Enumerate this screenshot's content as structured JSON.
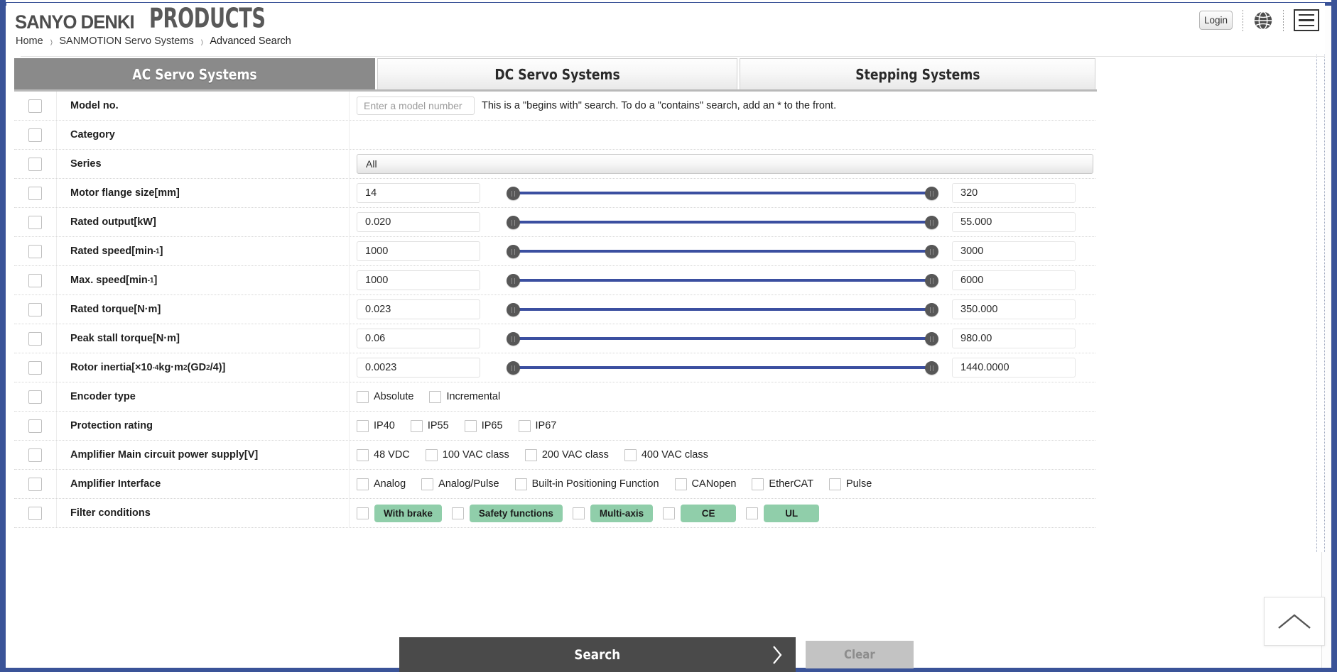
{
  "header": {
    "brand_primary": "SANYO DENKI",
    "brand_secondary": "PRODUCTS",
    "breadcrumb": [
      {
        "label": "Home"
      },
      {
        "label": "SANMOTION Servo Systems"
      },
      {
        "label": "Advanced Search"
      }
    ],
    "breadcrumb_separator": "›",
    "login_label": "Login",
    "globe_icon": "globe-icon",
    "menu_icon": "hamburger-menu-icon"
  },
  "tabs": [
    {
      "label": "AC Servo Systems",
      "active": true
    },
    {
      "label": "DC Servo Systems",
      "active": false
    },
    {
      "label": "Stepping Systems",
      "active": false
    }
  ],
  "rows": {
    "model_no": {
      "label": "Model no.",
      "placeholder": "Enter a model number",
      "value": "",
      "hint": "This is a \"begins with\" search. To do a \"contains\" search, add an * to the front."
    },
    "category": {
      "label": "Category"
    },
    "series": {
      "label": "Series",
      "selected": "All"
    },
    "motor_flange": {
      "label_html": "Motor flange size[mm]",
      "min": "14",
      "max": "320"
    },
    "rated_output": {
      "label_html": "Rated output[kW]",
      "min": "0.020",
      "max": "55.000"
    },
    "rated_speed": {
      "label_prefix": "Rated speed[min",
      "label_sup": "-1",
      "label_suffix": "]",
      "min": "1000",
      "max": "3000"
    },
    "max_speed": {
      "label_prefix": "Max. speed[min",
      "label_sup": "-1",
      "label_suffix": "]",
      "min": "1000",
      "max": "6000"
    },
    "rated_torque": {
      "label_html": "Rated torque[N·m]",
      "min": "0.023",
      "max": "350.000"
    },
    "peak_stall_torque": {
      "label_html": "Peak stall torque[N·m]",
      "min": "0.06",
      "max": "980.00"
    },
    "rotor_inertia": {
      "label_p1": "Rotor inertia[×10",
      "label_s1": "-4",
      "label_p2": "kg·m",
      "label_s2": "2",
      "label_p3": " (GD",
      "label_s3": "2",
      "label_p4": "/4)]",
      "min": "0.0023",
      "max": "1440.0000"
    },
    "encoder_type": {
      "label": "Encoder type",
      "options": [
        {
          "label": "Absolute",
          "checked": false
        },
        {
          "label": "Incremental",
          "checked": false
        }
      ]
    },
    "protection_rating": {
      "label": "Protection rating",
      "options": [
        {
          "label": "IP40",
          "checked": false
        },
        {
          "label": "IP55",
          "checked": false
        },
        {
          "label": "IP65",
          "checked": false
        },
        {
          "label": "IP67",
          "checked": false
        }
      ]
    },
    "amp_power_supply": {
      "label": "Amplifier Main circuit power supply[V]",
      "options": [
        {
          "label": "48 VDC",
          "checked": false
        },
        {
          "label": "100 VAC class",
          "checked": false
        },
        {
          "label": "200 VAC class",
          "checked": false
        },
        {
          "label": "400 VAC class",
          "checked": false
        }
      ]
    },
    "amp_interface": {
      "label": "Amplifier Interface",
      "options": [
        {
          "label": "Analog",
          "checked": false
        },
        {
          "label": "Analog/Pulse",
          "checked": false
        },
        {
          "label": "Built-in Positioning Function",
          "checked": false
        },
        {
          "label": "CANopen",
          "checked": false
        },
        {
          "label": "EtherCAT",
          "checked": false
        },
        {
          "label": "Pulse",
          "checked": false
        }
      ]
    },
    "filter_conditions": {
      "label": "Filter conditions",
      "options": [
        {
          "label": "With brake",
          "checked": false
        },
        {
          "label": "Safety functions",
          "checked": false
        },
        {
          "label": "Multi-axis",
          "checked": false
        },
        {
          "label": "CE",
          "checked": false
        },
        {
          "label": "UL",
          "checked": false
        }
      ]
    }
  },
  "footer": {
    "search_label": "Search",
    "clear_label": "Clear",
    "back_to_top_icon": "chevron-up-icon"
  },
  "colors": {
    "page_border_blue": "#3a5398",
    "active_tab_gray": "#8a8a8a",
    "slider_blue": "#3b4fa0",
    "badge_green": "#90ceaa",
    "search_button_gray": "#4a4a4a",
    "clear_button_gray": "#c3c3c3"
  }
}
